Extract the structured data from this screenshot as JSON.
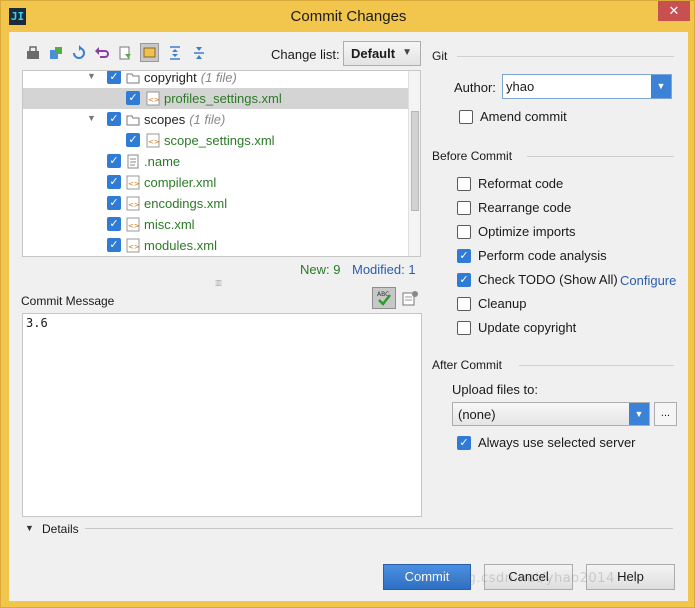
{
  "window": {
    "title": "Commit Changes",
    "app_icon_text": "JI",
    "close_glyph": "✕"
  },
  "toolbar": {
    "icons": [
      "refresh-changes-icon",
      "move-to-changelist-icon",
      "rollback-icon",
      "undo-icon",
      "diff-icon",
      "group-by-directory-icon",
      "expand-all-icon",
      "collapse-all-icon"
    ],
    "changelist_label": "Change list:",
    "changelist_value": "Default"
  },
  "tree": {
    "rows": [
      {
        "name": "copyright",
        "count": "(1 file)",
        "type": "folder",
        "green": false
      },
      {
        "name": "profiles_settings.xml",
        "type": "xml",
        "green": true
      },
      {
        "name": "scopes",
        "count": "(1 file)",
        "type": "folder",
        "green": false
      },
      {
        "name": "scope_settings.xml",
        "type": "xml",
        "green": true
      },
      {
        "name": ".name",
        "type": "text",
        "green": true
      },
      {
        "name": "compiler.xml",
        "type": "xml",
        "green": true
      },
      {
        "name": "encodings.xml",
        "type": "xml",
        "green": true
      },
      {
        "name": "misc.xml",
        "type": "xml",
        "green": true
      },
      {
        "name": "modules.xml",
        "type": "xml",
        "green": true
      }
    ]
  },
  "stats": {
    "new": "New: 9",
    "modified": "Modified: 1"
  },
  "commit_message": {
    "label": "Commit Message",
    "value": "3.6"
  },
  "details": {
    "label": "Details"
  },
  "git": {
    "section": "Git",
    "author_label": "Author:",
    "author_value": "yhao",
    "amend_label": "Amend commit",
    "amend_checked": false
  },
  "before_commit": {
    "section": "Before Commit",
    "options": [
      {
        "label": "Reformat code",
        "checked": false
      },
      {
        "label": "Rearrange code",
        "checked": false
      },
      {
        "label": "Optimize imports",
        "checked": false
      },
      {
        "label": "Perform code analysis",
        "checked": true
      },
      {
        "label": "Check TODO (Show All)",
        "checked": true
      },
      {
        "label": "Cleanup",
        "checked": false
      },
      {
        "label": "Update copyright",
        "checked": false
      }
    ],
    "configure_link": "Configure"
  },
  "after_commit": {
    "section": "After Commit",
    "upload_label": "Upload files to:",
    "server_value": "(none)",
    "browse_label": "...",
    "always_use_label": "Always use selected server",
    "always_use_checked": true
  },
  "buttons": {
    "commit": "Commit",
    "cancel": "Cancel",
    "help": "Help"
  },
  "watermark": "http://blog.csdn.net/yhao2014",
  "colors": {
    "accent": "#2f7bd6",
    "title_bar": "#f2c64c",
    "added_file": "#2b7a26",
    "link": "#2a5db0"
  }
}
